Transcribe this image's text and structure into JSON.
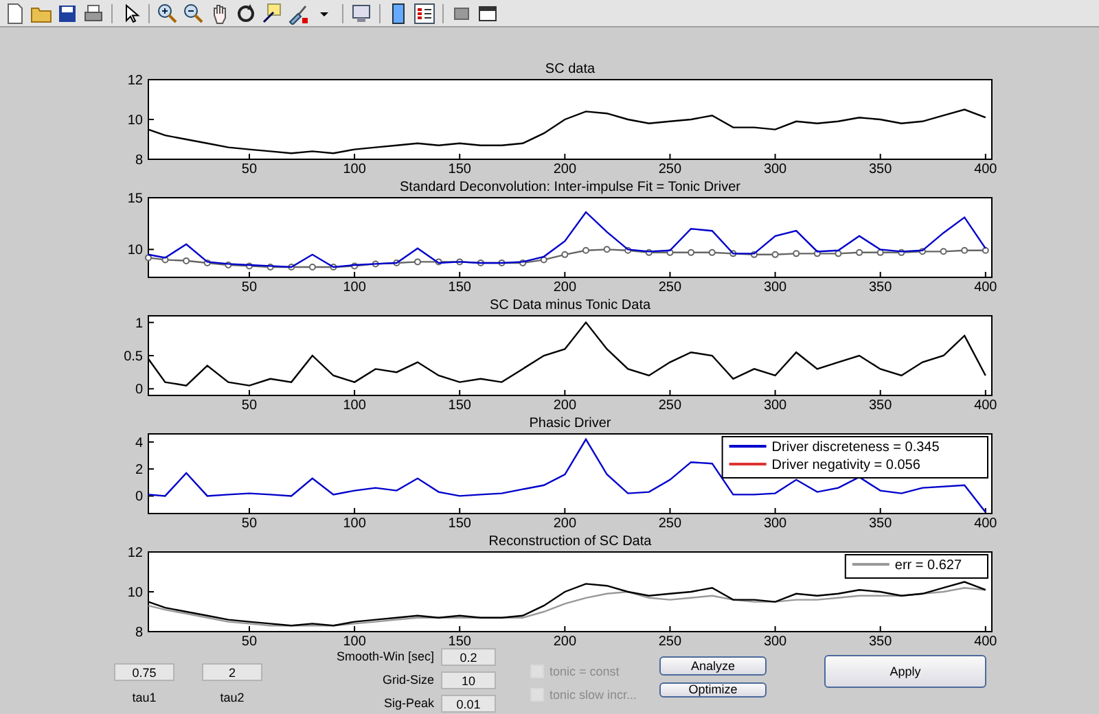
{
  "panels": [
    {
      "chart_data": {
        "type": "line",
        "title": "SC data",
        "x": [
          2,
          10,
          20,
          30,
          40,
          50,
          60,
          70,
          80,
          90,
          100,
          110,
          120,
          130,
          140,
          150,
          160,
          170,
          180,
          190,
          200,
          210,
          220,
          230,
          240,
          250,
          260,
          270,
          280,
          290,
          300,
          310,
          320,
          330,
          340,
          350,
          360,
          370,
          380,
          390,
          400
        ],
        "xlim": [
          2,
          403
        ],
        "ylim": [
          8,
          12
        ],
        "xticks": [
          50,
          100,
          150,
          200,
          250,
          300,
          350,
          400
        ],
        "yticks": [
          8,
          10,
          12
        ],
        "series": [
          {
            "color": "#000000",
            "values": [
              9.5,
              9.2,
              9.0,
              8.8,
              8.6,
              8.5,
              8.4,
              8.3,
              8.4,
              8.3,
              8.5,
              8.6,
              8.7,
              8.8,
              8.7,
              8.8,
              8.7,
              8.7,
              8.8,
              9.3,
              10.0,
              10.4,
              10.3,
              10.0,
              9.8,
              9.9,
              10.0,
              10.2,
              9.6,
              9.6,
              9.5,
              9.9,
              9.8,
              9.9,
              10.1,
              10.0,
              9.8,
              9.9,
              10.2,
              10.5,
              10.1
            ]
          }
        ]
      }
    },
    {
      "chart_data": {
        "type": "line",
        "title": "Standard Deconvolution: Inter-impulse Fit = Tonic Driver",
        "x": [
          2,
          10,
          20,
          30,
          40,
          50,
          60,
          70,
          80,
          90,
          100,
          110,
          120,
          130,
          140,
          150,
          160,
          170,
          180,
          190,
          200,
          210,
          220,
          230,
          240,
          250,
          260,
          270,
          280,
          290,
          300,
          310,
          320,
          330,
          340,
          350,
          360,
          370,
          380,
          390,
          400
        ],
        "xlim": [
          2,
          403
        ],
        "ylim": [
          7.3,
          15
        ],
        "xticks": [
          50,
          100,
          150,
          200,
          250,
          300,
          350,
          400
        ],
        "yticks": [
          10,
          15
        ],
        "series": [
          {
            "color": "#666666",
            "marker": "o",
            "values": [
              9.2,
              9.0,
              8.9,
              8.7,
              8.5,
              8.4,
              8.3,
              8.3,
              8.3,
              8.3,
              8.4,
              8.6,
              8.7,
              8.8,
              8.8,
              8.8,
              8.7,
              8.7,
              8.7,
              9.0,
              9.5,
              9.9,
              10.0,
              9.9,
              9.7,
              9.7,
              9.7,
              9.7,
              9.6,
              9.5,
              9.5,
              9.6,
              9.6,
              9.6,
              9.7,
              9.7,
              9.7,
              9.8,
              9.8,
              9.9,
              9.9
            ]
          },
          {
            "color": "#0000cc",
            "values": [
              9.5,
              9.2,
              10.5,
              8.8,
              8.6,
              8.5,
              8.4,
              8.3,
              9.5,
              8.3,
              8.5,
              8.6,
              8.7,
              10.1,
              8.7,
              8.8,
              8.7,
              8.7,
              8.8,
              9.3,
              10.8,
              13.6,
              11.7,
              10.0,
              9.8,
              9.9,
              12.0,
              11.8,
              9.6,
              9.6,
              11.3,
              11.8,
              9.8,
              9.9,
              11.3,
              10.0,
              9.8,
              9.9,
              11.6,
              13.1,
              10.1
            ]
          }
        ]
      }
    },
    {
      "chart_data": {
        "type": "line",
        "title": "SC Data minus Tonic Data",
        "x": [
          2,
          10,
          20,
          30,
          40,
          50,
          60,
          70,
          80,
          90,
          100,
          110,
          120,
          130,
          140,
          150,
          160,
          170,
          180,
          190,
          200,
          210,
          220,
          230,
          240,
          250,
          260,
          270,
          280,
          290,
          300,
          310,
          320,
          330,
          340,
          350,
          360,
          370,
          380,
          390,
          400
        ],
        "xlim": [
          2,
          403
        ],
        "ylim": [
          -0.1,
          1.1
        ],
        "xticks": [
          50,
          100,
          150,
          200,
          250,
          300,
          350,
          400
        ],
        "yticks": [
          0,
          0.5,
          1
        ],
        "series": [
          {
            "color": "#000000",
            "values": [
              0.45,
              0.1,
              0.05,
              0.35,
              0.1,
              0.05,
              0.15,
              0.1,
              0.5,
              0.2,
              0.1,
              0.3,
              0.25,
              0.4,
              0.2,
              0.1,
              0.15,
              0.1,
              0.3,
              0.5,
              0.6,
              1.0,
              0.6,
              0.3,
              0.2,
              0.4,
              0.55,
              0.5,
              0.15,
              0.3,
              0.2,
              0.55,
              0.3,
              0.4,
              0.5,
              0.3,
              0.2,
              0.4,
              0.5,
              0.8,
              0.2
            ]
          }
        ]
      }
    },
    {
      "chart_data": {
        "type": "line",
        "title": "Phasic Driver",
        "x": [
          2,
          10,
          20,
          30,
          40,
          50,
          60,
          70,
          80,
          90,
          100,
          110,
          120,
          130,
          140,
          150,
          160,
          170,
          180,
          190,
          200,
          210,
          220,
          230,
          240,
          250,
          260,
          270,
          280,
          290,
          300,
          310,
          320,
          330,
          340,
          350,
          360,
          370,
          380,
          390,
          400
        ],
        "xlim": [
          2,
          403
        ],
        "ylim": [
          -1.3,
          4.6
        ],
        "xticks": [
          50,
          100,
          150,
          200,
          250,
          300,
          350,
          400
        ],
        "yticks": [
          0,
          2,
          4
        ],
        "series": [
          {
            "color": "#0000cc",
            "values": [
              0.1,
              0,
              1.7,
              0,
              0.1,
              0.2,
              0.1,
              0,
              1.3,
              0.1,
              0.4,
              0.6,
              0.4,
              1.3,
              0.3,
              0,
              0.1,
              0.2,
              0.5,
              0.8,
              1.6,
              4.2,
              1.6,
              0.2,
              0.3,
              1.2,
              2.5,
              2.4,
              0.1,
              0.1,
              0.2,
              1.2,
              0.3,
              0.6,
              1.4,
              0.4,
              0.2,
              0.6,
              null,
              0.8,
              -1.2
            ]
          }
        ]
      },
      "legend": [
        {
          "label": "Driver discreteness = 0.345",
          "color": "#0000cc"
        },
        {
          "label": "Driver negativity = 0.056",
          "color": "#dd3333"
        }
      ]
    },
    {
      "chart_data": {
        "type": "line",
        "title": "Reconstruction of SC Data",
        "x": [
          2,
          10,
          20,
          30,
          40,
          50,
          60,
          70,
          80,
          90,
          100,
          110,
          120,
          130,
          140,
          150,
          160,
          170,
          180,
          190,
          200,
          210,
          220,
          230,
          240,
          250,
          260,
          270,
          280,
          290,
          300,
          310,
          320,
          330,
          340,
          350,
          360,
          370,
          380,
          390,
          400
        ],
        "xlim": [
          2,
          403
        ],
        "ylim": [
          8,
          12
        ],
        "xticks": [
          50,
          100,
          150,
          200,
          250,
          300,
          350,
          400
        ],
        "yticks": [
          8,
          10,
          12
        ],
        "series": [
          {
            "color": "#999999",
            "values": [
              9.3,
              9.1,
              8.9,
              8.7,
              8.5,
              8.4,
              8.3,
              8.3,
              8.3,
              8.3,
              8.4,
              8.5,
              8.6,
              8.7,
              8.7,
              8.7,
              8.7,
              8.7,
              8.7,
              9.0,
              9.4,
              9.7,
              9.9,
              10.0,
              9.7,
              9.6,
              9.7,
              9.8,
              9.6,
              9.5,
              9.5,
              9.6,
              9.6,
              9.7,
              9.8,
              9.8,
              9.8,
              9.9,
              10.0,
              10.2,
              10.1
            ]
          },
          {
            "color": "#000000",
            "values": [
              9.5,
              9.2,
              9.0,
              8.8,
              8.6,
              8.5,
              8.4,
              8.3,
              8.4,
              8.3,
              8.5,
              8.6,
              8.7,
              8.8,
              8.7,
              8.8,
              8.7,
              8.7,
              8.8,
              9.3,
              10.0,
              10.4,
              10.3,
              10.0,
              9.8,
              9.9,
              10.0,
              10.2,
              9.6,
              9.6,
              9.5,
              9.9,
              9.8,
              9.9,
              10.1,
              10.0,
              9.8,
              9.9,
              10.2,
              10.5,
              10.1
            ]
          }
        ]
      },
      "legend": [
        {
          "label": "err = 0.627",
          "color": "#999999"
        }
      ]
    }
  ],
  "taus": [
    {
      "value": "0.75",
      "label": "tau1"
    },
    {
      "value": "2",
      "label": "tau2"
    }
  ],
  "params": [
    {
      "label": "Smooth-Win [sec]",
      "value": "0.2"
    },
    {
      "label": "Grid-Size",
      "value": "10"
    },
    {
      "label": "Sig-Peak",
      "value": "0.01"
    }
  ],
  "options": [
    {
      "label": "tonic = const",
      "checked": false,
      "disabled": true
    },
    {
      "label": "tonic slow incr...",
      "checked": false,
      "disabled": true
    }
  ],
  "buttons": [
    {
      "label": "Analyze"
    },
    {
      "label": "Optimize"
    }
  ],
  "apply_button": {
    "label": "Apply"
  }
}
